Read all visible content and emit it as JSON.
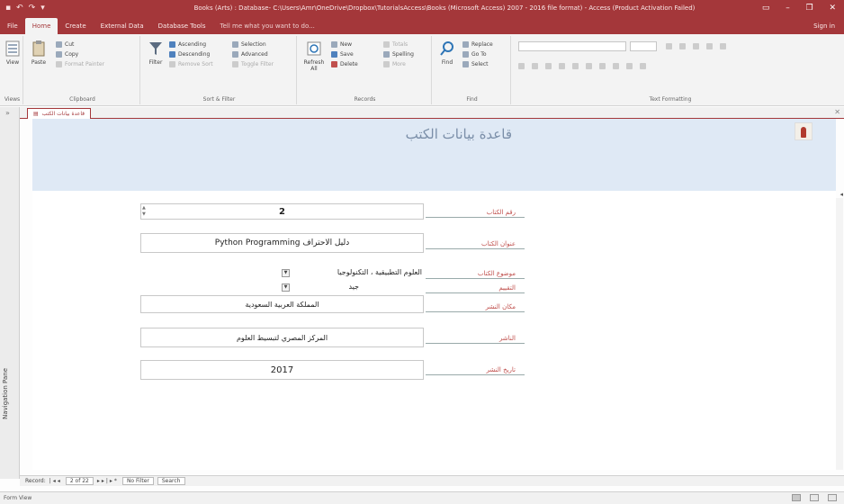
{
  "window": {
    "title": "Books (Arts) : Database- C:\\Users\\Amr\\OneDrive\\Dropbox\\TutorialsAccess\\Books (Microsoft Access) 2007 - 2016 file format) - Access (Product Activation Failed)"
  },
  "tabs": [
    "File",
    "Home",
    "Create",
    "External Data",
    "Database Tools"
  ],
  "active_tab": "Home",
  "tell_me": "Tell me what you want to do...",
  "sign_in": "Sign in",
  "ribbon": {
    "groups": [
      "Views",
      "Clipboard",
      "Sort & Filter",
      "Records",
      "Find",
      "Text Formatting"
    ],
    "views_btn": "View",
    "paste_btn": "Paste",
    "cut": "Cut",
    "copy": "Copy",
    "format_painter": "Format Painter",
    "filter_btn": "Filter",
    "ascending": "Ascending",
    "descending": "Descending",
    "remove_sort": "Remove Sort",
    "selection": "Selection",
    "advanced": "Advanced",
    "toggle_filter": "Toggle Filter",
    "refresh_all": "Refresh All",
    "new": "New",
    "save": "Save",
    "delete": "Delete",
    "totals": "Totals",
    "spelling": "Spelling",
    "more": "More",
    "find_btn": "Find",
    "replace": "Replace",
    "go_to": "Go To",
    "select": "Select"
  },
  "nav_pane": {
    "label": "Navigation Pane"
  },
  "doc_tab": {
    "label": "قاعدة بيانات الكتب"
  },
  "form": {
    "title": "قاعدة بيانات الكتب",
    "fields": [
      {
        "label": "رقم الكتاب",
        "value": "2"
      },
      {
        "label": "عنوان الكتاب",
        "value": "دليل الاحتراف Python Programming"
      },
      {
        "label": "موضوع الكتاب",
        "value": "العلوم التطبيقية ، التكنولوجيا"
      },
      {
        "label": "التقييم",
        "value": "جيد"
      },
      {
        "label": "مكان النشر",
        "value": "المملكة العربية السعودية"
      },
      {
        "label": "الناشر",
        "value": "المركز المصري لتبسيط العلوم"
      },
      {
        "label": "تاريخ النشر",
        "value": "2017"
      }
    ]
  },
  "record_nav": {
    "record_label": "Record:",
    "position": "2 of 22",
    "filter_state": "No Filter",
    "search": "Search"
  },
  "status": {
    "text": "Form View"
  }
}
